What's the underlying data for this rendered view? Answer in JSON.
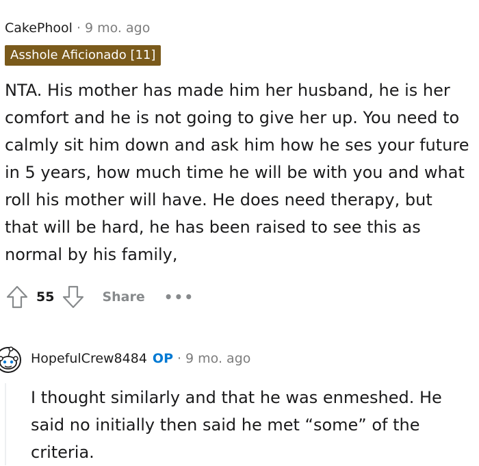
{
  "comment1": {
    "username": "CakePhool",
    "separator": "·",
    "time": "9 mo. ago",
    "flair": "Asshole Aficionado [11]",
    "flair_color": "#7a5a1b",
    "body": "NTA. His mother has made him her husband, he is her comfort and he is not going to give her up. You need to calmly sit him down and ask him how he ses your future in 5 years, how much time he will be with you and what roll his mother will have. He does need therapy, but that will be hard, he has been raised to see this as normal by his family,",
    "score": "55",
    "share_label": "Share",
    "more_label": "•••",
    "icons": [
      "upvote-arrow-icon",
      "downvote-arrow-icon"
    ]
  },
  "comment2": {
    "avatar_icon": "reddit-snoo-avatar-icon",
    "username": "HopefulCrew8484",
    "op_badge": "OP",
    "op_color": "#0079d3",
    "separator": "·",
    "time": "9 mo. ago",
    "body": "I thought similarly and that he was enmeshed. He said no initially then said he met “some” of the criteria."
  }
}
